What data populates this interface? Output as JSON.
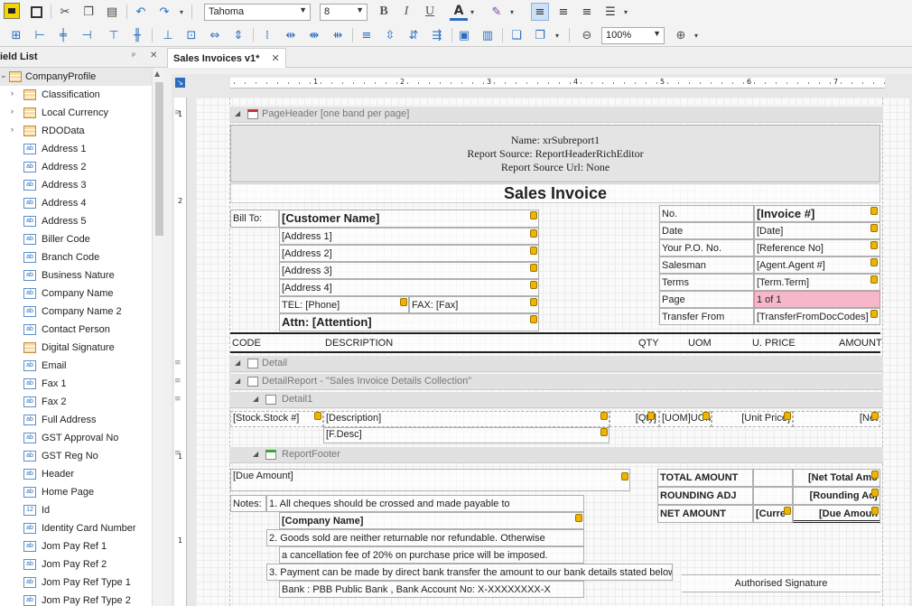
{
  "toolbar": {
    "font_family": "Tahoma",
    "font_size": "8",
    "bold": "B",
    "italic": "I",
    "underline": "U",
    "font_color": "A",
    "zoom": "100%"
  },
  "field_list": {
    "title": "ield List",
    "pin": "ᵖ",
    "close": "✕",
    "root": "CompanyProfile",
    "items": [
      {
        "label": "Classification",
        "expandable": true,
        "type": "table"
      },
      {
        "label": "Local Currency",
        "expandable": true,
        "type": "table"
      },
      {
        "label": "RDOData",
        "expandable": true,
        "type": "table"
      },
      {
        "label": "Address 1",
        "type": "ab"
      },
      {
        "label": "Address 2",
        "type": "ab"
      },
      {
        "label": "Address 3",
        "type": "ab"
      },
      {
        "label": "Address 4",
        "type": "ab"
      },
      {
        "label": "Address 5",
        "type": "ab"
      },
      {
        "label": "Biller Code",
        "type": "ab"
      },
      {
        "label": "Branch Code",
        "type": "ab"
      },
      {
        "label": "Business Nature",
        "type": "ab"
      },
      {
        "label": "Company Name",
        "type": "ab"
      },
      {
        "label": "Company Name 2",
        "type": "ab"
      },
      {
        "label": "Contact Person",
        "type": "ab"
      },
      {
        "label": "Digital Signature",
        "type": "table"
      },
      {
        "label": "Email",
        "type": "ab"
      },
      {
        "label": "Fax 1",
        "type": "ab"
      },
      {
        "label": "Fax 2",
        "type": "ab"
      },
      {
        "label": "Full Address",
        "type": "ab"
      },
      {
        "label": "GST Approval No",
        "type": "ab"
      },
      {
        "label": "GST Reg No",
        "type": "ab"
      },
      {
        "label": "Header",
        "type": "ab"
      },
      {
        "label": "Home Page",
        "type": "ab"
      },
      {
        "label": "Id",
        "type": "12"
      },
      {
        "label": "Identity Card Number",
        "type": "ab"
      },
      {
        "label": "Jom Pay Ref 1",
        "type": "ab"
      },
      {
        "label": "Jom Pay Ref 2",
        "type": "ab"
      },
      {
        "label": "Jom Pay Ref Type 1",
        "type": "ab"
      },
      {
        "label": "Jom Pay Ref Type 2",
        "type": "ab"
      }
    ]
  },
  "tab": {
    "label": "Sales Invoices v1*",
    "close": "✕"
  },
  "ruler": {
    "h": [
      "1",
      "2",
      "3",
      "4",
      "5",
      "6",
      "7"
    ],
    "v": [
      "1",
      "2",
      "1",
      "1"
    ]
  },
  "bands": {
    "page_header": "PageHeader [one band per page]",
    "detail": "Detail",
    "detail_report": "DetailReport - \"Sales Invoice Details Collection\"",
    "detail1": "Detail1",
    "report_footer": "ReportFooter"
  },
  "header": {
    "sub1": "Name: xrSubreport1",
    "sub2": "Report Source: ReportHeaderRichEditor",
    "sub3": "Report Source Url: None",
    "title": "Sales Invoice",
    "bill_to": "Bill To:",
    "customer": "[Customer Name]",
    "addr1": "[Address 1]",
    "addr2": "[Address 2]",
    "addr3": "[Address 3]",
    "addr4": "[Address 4]",
    "tel": "TEL: [Phone]",
    "fax": "FAX: [Fax]",
    "attn": "Attn: [Attention]",
    "right_labels": [
      "No.",
      "Date",
      "Your P.O. No.",
      "Salesman",
      "Terms",
      "Page",
      "Transfer From"
    ],
    "right_values": [
      "[Invoice #]",
      "[Date]",
      "[Reference No]",
      "[Agent.Agent #]",
      "[Term.Term]",
      "1 of 1",
      "[TransferFromDocCodes]"
    ],
    "columns": [
      "CODE",
      "DESCRIPTION",
      "QTY",
      "UOM",
      "U. PRICE",
      "AMOUNT"
    ]
  },
  "detail1": {
    "stock": "[Stock.Stock #]",
    "desc": "[Description]",
    "qty": "[Qty]",
    "uom": "[UOM]UOM",
    "price": "[Unit Price]",
    "amount": "[Net",
    "fdesc": "[F.Desc]"
  },
  "footer": {
    "due": "[Due Amount]",
    "notes_label": "Notes:",
    "note1": "1. All cheques should be crossed and made payable to",
    "company": "[Company Name]",
    "note2": "2. Goods sold are neither returnable nor refundable. Otherwise",
    "note2b": "a cancellation fee of 20% on purchase price will be imposed.",
    "note3": "3. Payment can be made by direct bank transfer the amount to our bank details stated below.",
    "bank": "Bank : PBB Public Bank , Bank Account No: X-XXXXXXXX-X",
    "total_label": "TOTAL AMOUNT",
    "total_val": "[Net Total Amo",
    "round_label": "ROUNDING ADJ",
    "round_val": "[Rounding Adj",
    "net_label": "NET AMOUNT",
    "net_cur": "[Curre",
    "net_val": "[Due Amoun",
    "signature": "Authorised Signature"
  }
}
